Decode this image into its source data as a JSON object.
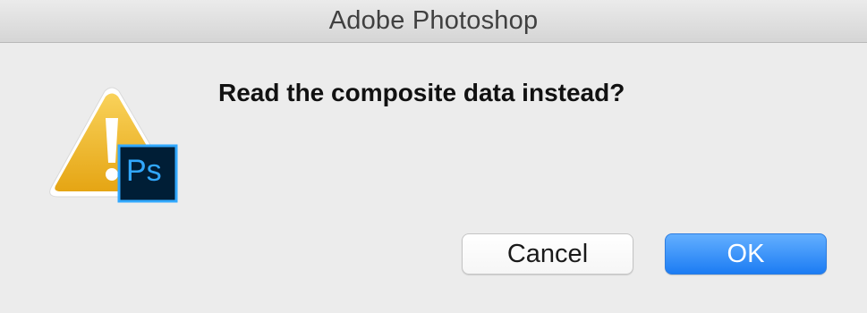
{
  "window": {
    "title": "Adobe Photoshop"
  },
  "dialog": {
    "message": "Read the composite data instead?",
    "icon": "warning-photoshop-icon",
    "badge_text": "Ps",
    "buttons": {
      "cancel_label": "Cancel",
      "ok_label": "OK"
    }
  },
  "colors": {
    "accent": "#1c7cf3",
    "warning": "#f0b429",
    "ps_badge": "#31a8ff"
  }
}
